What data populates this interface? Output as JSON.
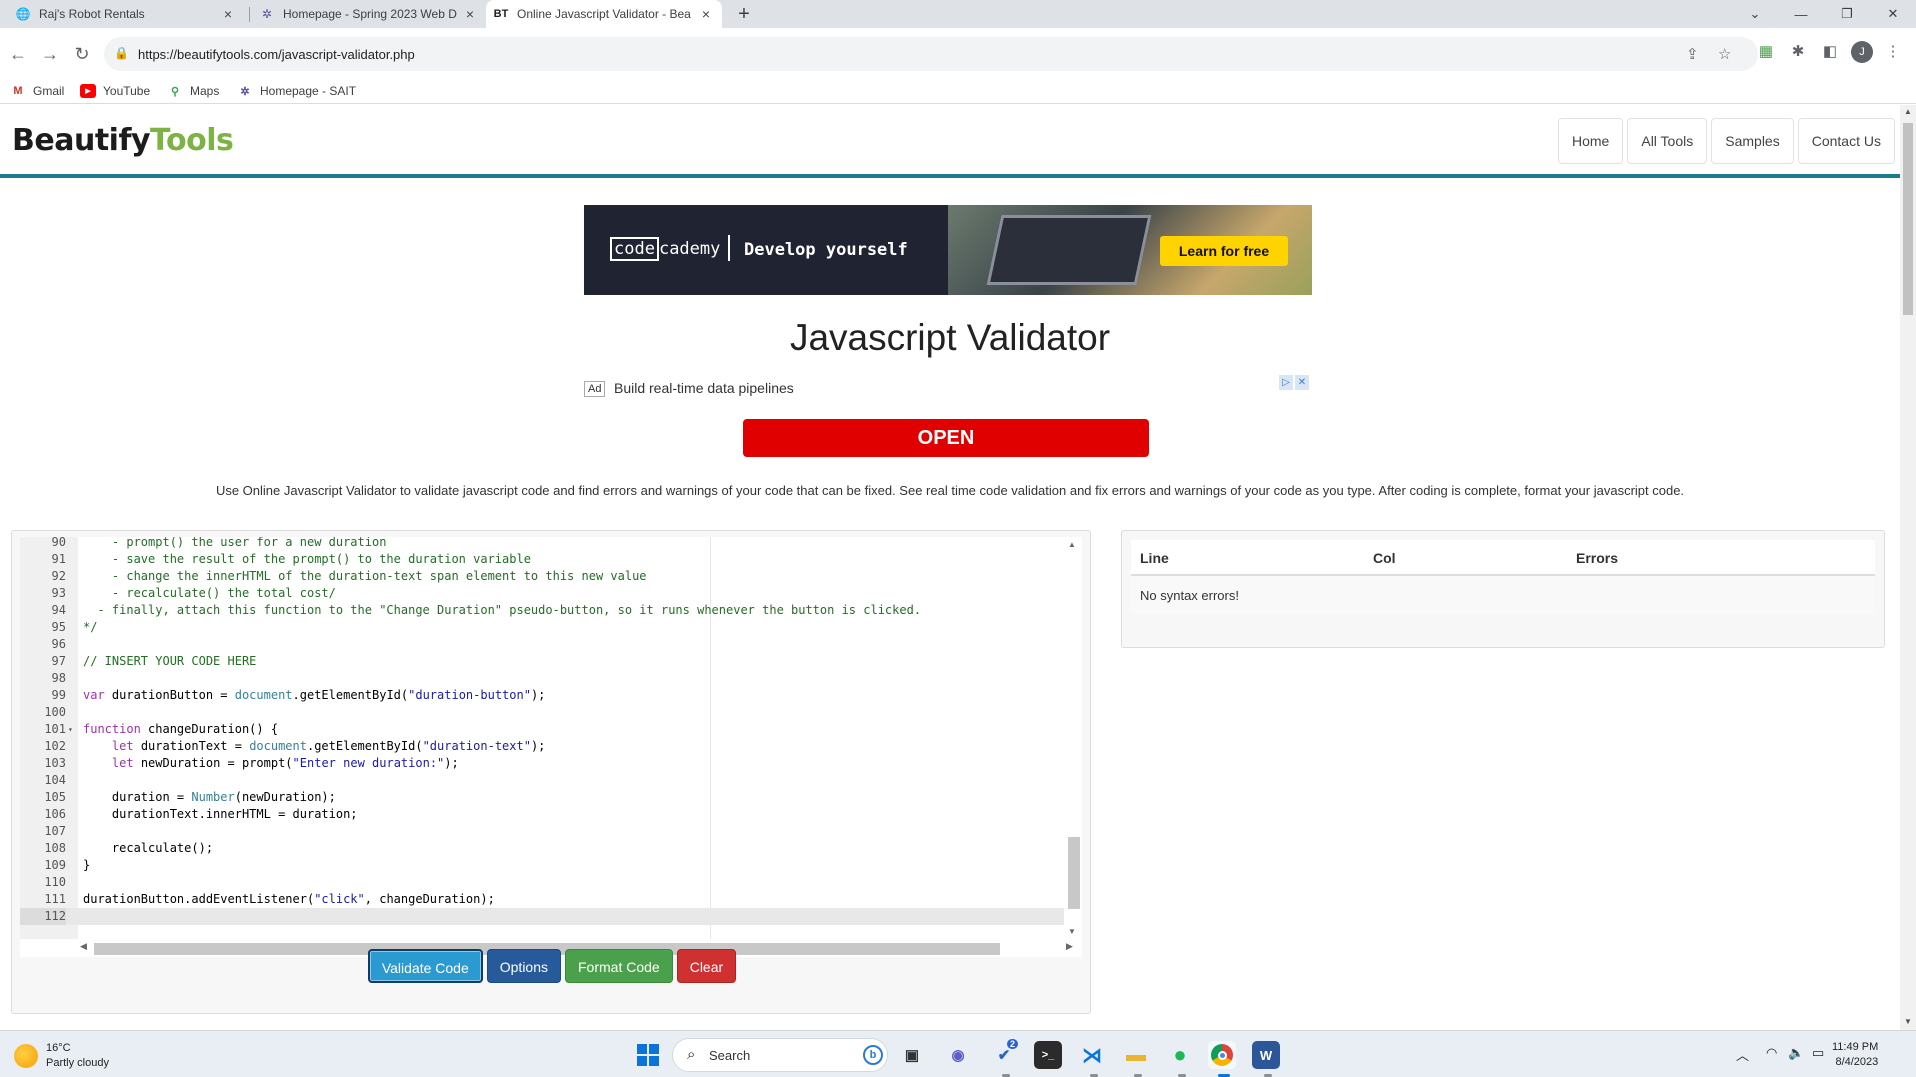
{
  "browser": {
    "tabs": [
      {
        "title": "Raj's Robot Rentals",
        "favicon": "globe-icon"
      },
      {
        "title": "Homepage - Spring 2023 Web D",
        "favicon": "sait-icon"
      },
      {
        "title": "Online Javascript Validator - Bea",
        "favicon": "BT"
      }
    ],
    "new_tab": "+",
    "url": "https://beautifytools.com/javascript-validator.php",
    "profile_initial": "J",
    "bookmarks": [
      {
        "label": "Gmail",
        "icon": "M"
      },
      {
        "label": "YouTube",
        "icon": "▶"
      },
      {
        "label": "Maps",
        "icon": "⚲"
      },
      {
        "label": "Homepage - SAIT",
        "icon": "✲"
      }
    ]
  },
  "site": {
    "logo_part1": "Beautify",
    "logo_part2": "Tools",
    "nav": [
      "Home",
      "All Tools",
      "Samples",
      "Contact Us"
    ]
  },
  "banner_ad": {
    "brand_boxed": "code",
    "brand_rest": "cademy",
    "slogan": "Develop yourself",
    "cta": "Learn for free"
  },
  "page": {
    "title": "Javascript Validator",
    "intro": "Use Online Javascript Validator to validate javascript code and find errors and warnings of your code that can be fixed. See real time code validation and fix errors and warnings of your code as you type. After coding is complete, format your javascript code."
  },
  "text_ad": {
    "badge": "Ad",
    "text": "Build real-time data pipelines",
    "button": "OPEN"
  },
  "editor": {
    "lines": [
      {
        "n": "90",
        "code": "    - prompt() the user for a new duration"
      },
      {
        "n": "91",
        "code": "    - save the result of the prompt() to the duration variable"
      },
      {
        "n": "92",
        "code": "    - change the innerHTML of the duration-text span element to this new value"
      },
      {
        "n": "93",
        "code": "    - recalculate() the total cost/"
      },
      {
        "n": "94",
        "code": "  - finally, attach this function to the \"Change Duration\" pseudo-button, so it runs whenever the button is clicked."
      },
      {
        "n": "95",
        "code": "*/"
      },
      {
        "n": "96",
        "code": ""
      },
      {
        "n": "97",
        "code": "// INSERT YOUR CODE HERE"
      },
      {
        "n": "98",
        "code": ""
      },
      {
        "n": "99",
        "code": "var durationButton = document.getElementById(\"duration-button\");"
      },
      {
        "n": "100",
        "code": ""
      },
      {
        "n": "101",
        "code": "function changeDuration() {"
      },
      {
        "n": "102",
        "code": "    let durationText = document.getElementById(\"duration-text\");"
      },
      {
        "n": "103",
        "code": "    let newDuration = prompt(\"Enter new duration:\");"
      },
      {
        "n": "104",
        "code": ""
      },
      {
        "n": "105",
        "code": "    duration = Number(newDuration);"
      },
      {
        "n": "106",
        "code": "    durationText.innerHTML = duration;"
      },
      {
        "n": "107",
        "code": ""
      },
      {
        "n": "108",
        "code": "    recalculate();"
      },
      {
        "n": "109",
        "code": "}"
      },
      {
        "n": "110",
        "code": ""
      },
      {
        "n": "111",
        "code": "durationButton.addEventListener(\"click\", changeDuration);"
      },
      {
        "n": "112",
        "code": ""
      }
    ],
    "buttons": {
      "validate": "Validate Code",
      "options": "Options",
      "format": "Format Code",
      "clear": "Clear"
    }
  },
  "results": {
    "columns": [
      "Line",
      "Col",
      "Errors"
    ],
    "message": "No syntax errors!"
  },
  "taskbar": {
    "temperature": "16°C",
    "weather": "Partly cloudy",
    "search_placeholder": "Search",
    "time": "11:49 PM",
    "date": "8/4/2023",
    "badge_count": "2"
  }
}
